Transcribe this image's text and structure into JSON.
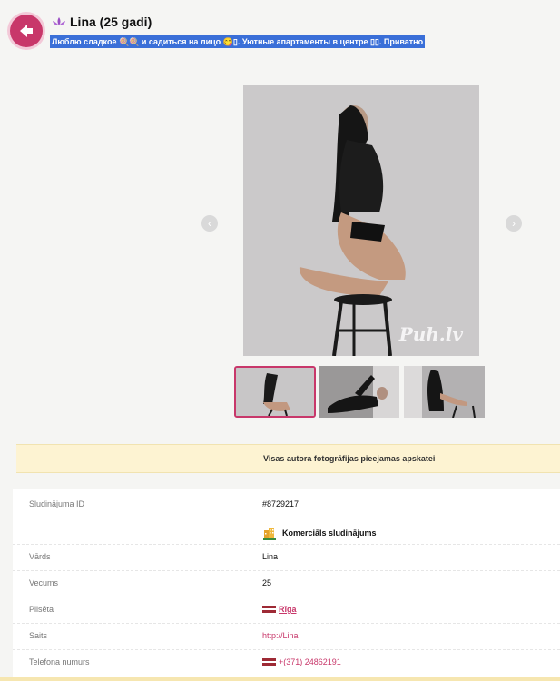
{
  "header": {
    "title": "Lina (25 gadi)",
    "subtitle": "Люблю сладкое 🍭🍭 и садиться на лицо 😋▯. Уютные апартаменты в центре ▯▯. Приватно"
  },
  "gallery": {
    "watermark": "Puh.lv",
    "prev_glyph": "‹",
    "next_glyph": "›",
    "thumbnails": [
      "photo-1",
      "photo-2",
      "photo-3"
    ]
  },
  "notice": "Visas autora fotogrāfijas pieejamas apskatei",
  "details": {
    "rows": [
      {
        "label": "Sludinājuma ID",
        "value": "#8729217"
      },
      {
        "label": "",
        "value": "Komerciāls sludinājums"
      },
      {
        "label": "Vārds",
        "value": "Lina"
      },
      {
        "label": "Vecums",
        "value": "25"
      },
      {
        "label": "Pilsēta",
        "value": "Rīga"
      },
      {
        "label": "Saits",
        "value": "http://Lina"
      },
      {
        "label": "Telefona numurs",
        "value": "+(371) 24862191"
      }
    ]
  },
  "colors": {
    "accent": "#c8376a",
    "highlight": "#3a6fd8",
    "notice_bg": "#fdf3d2",
    "page_bg": "#f5f5f3"
  },
  "icons": [
    "back-arrow-icon",
    "lotus-icon",
    "chevron-left-icon",
    "chevron-right-icon",
    "commercial-icon",
    "latvia-flag-icon"
  ]
}
